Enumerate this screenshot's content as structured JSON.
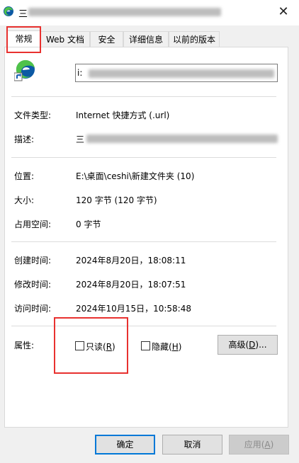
{
  "window": {
    "title": "三",
    "close_glyph": "✕",
    "icon": "edge-icon"
  },
  "tabs": [
    "常规",
    "Web 文档",
    "安全",
    "详细信息",
    "以前的版本"
  ],
  "general": {
    "name_value": "i:",
    "fields": {
      "type_label": "文件类型:",
      "type_value": "Internet 快捷方式 (.url)",
      "desc_label": "描述:",
      "desc_value": "三",
      "location_label": "位置:",
      "location_value": "E:\\桌面\\ceshi\\新建文件夹 (10)",
      "size_label": "大小:",
      "size_value": "120 字节 (120 字节)",
      "disk_label": "占用空间:",
      "disk_value": "0 字节",
      "created_label": "创建时间:",
      "created_value": "2024年8月20日，18:08:11",
      "modified_label": "修改时间:",
      "modified_value": "2024年8月20日，18:07:51",
      "accessed_label": "访问时间:",
      "accessed_value": "2024年10月15日，10:58:48",
      "attr_label": "属性:"
    },
    "attributes": {
      "readonly_text": "只读(",
      "readonly_key": "R",
      "readonly_close": ")",
      "readonly_checked": false,
      "hidden_text": "隐藏(",
      "hidden_key": "H",
      "hidden_close": ")",
      "hidden_checked": false,
      "advanced_text": "高级(",
      "advanced_key": "D",
      "advanced_close": ")..."
    }
  },
  "buttons": {
    "ok": "确定",
    "cancel": "取消",
    "apply_text": "应用(",
    "apply_key": "A",
    "apply_close": ")"
  },
  "colors": {
    "highlight": "#e8312f",
    "primary_border": "#0078d7",
    "edge_blue": "#0c59a4",
    "edge_green": "#4fc24a"
  }
}
